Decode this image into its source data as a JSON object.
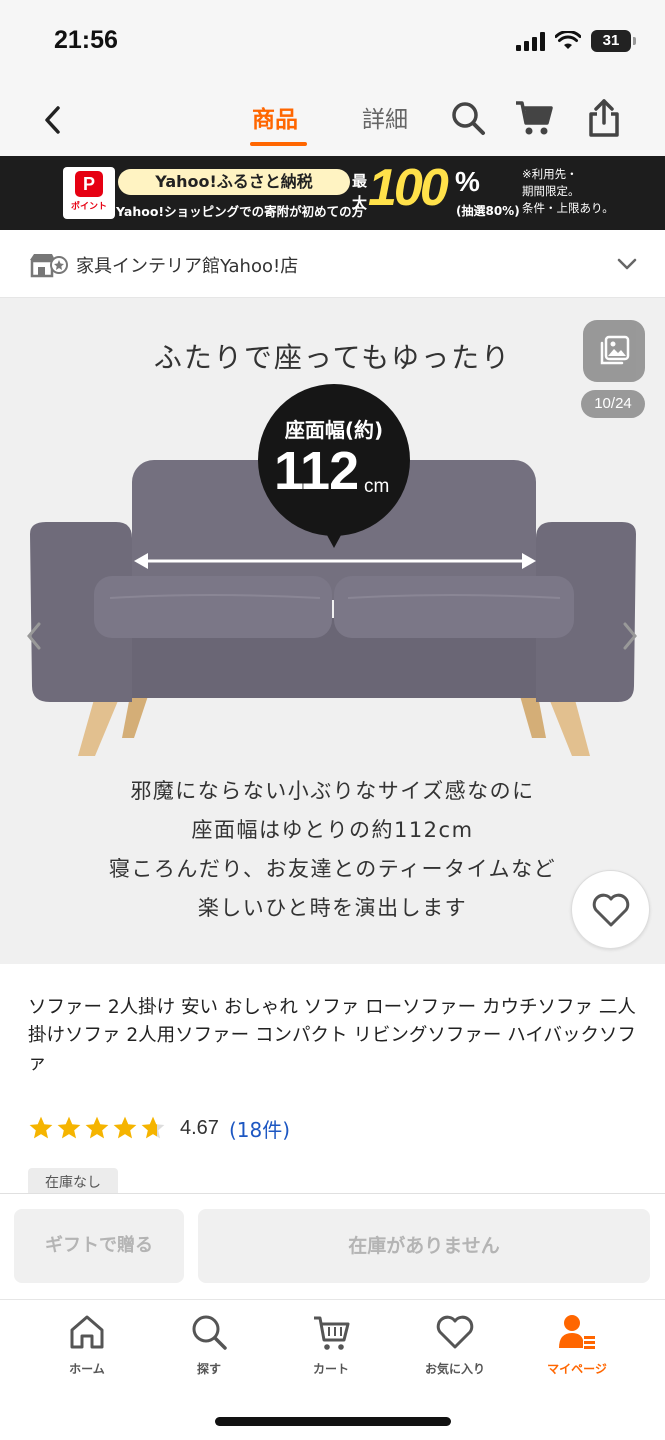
{
  "status_bar": {
    "time": "21:56",
    "battery": "31"
  },
  "header": {
    "tabs": [
      {
        "label": "商品",
        "active": true
      },
      {
        "label": "詳細",
        "active": false
      }
    ],
    "icons": [
      "back-arrow-icon",
      "search-icon",
      "cart-icon",
      "share-icon"
    ]
  },
  "banner": {
    "logo_p": "P",
    "logo_label": "ポイント",
    "headline": "Yahoo!ふるさと納税",
    "sub": "Yahoo!ショッピングでの寄附が初めての方",
    "max_label": "最大",
    "big_number": "100",
    "percent": "%",
    "lottery": "(抽選80%)",
    "note": "※利用先・\n期間限定。\n条件・上限あり。"
  },
  "store": {
    "name": "家具インテリア館Yahoo!店"
  },
  "gallery": {
    "headline": "ふたりで座ってもゆったり",
    "badge_label": "座面幅(約)",
    "badge_number": "112",
    "badge_unit": "cm",
    "caption_lines": [
      "邪魔にならない小ぶりなサイズ感なのに",
      "座面幅はゆとりの約112cm",
      "寝ころんだり、お友達とのティータイムなど",
      "楽しいひと時を演出します"
    ],
    "counter": "10/24"
  },
  "product": {
    "title": "ソファー 2人掛け 安い おしゃれ ソファ ローソファー カウチソファ 二人掛けソファ 2人用ソファー コンパクト リビングソファー ハイバックソファ",
    "rating": 4.67,
    "rating_text": "4.67",
    "review_count": "(18件)",
    "stock_tag": "在庫なし"
  },
  "actions": {
    "gift": "ギフトで贈る",
    "out_of_stock": "在庫がありません"
  },
  "tabbar": {
    "items": [
      {
        "label": "ホーム",
        "icon": "home-icon"
      },
      {
        "label": "探す",
        "icon": "search-icon"
      },
      {
        "label": "カート",
        "icon": "cart-icon"
      },
      {
        "label": "お気に入り",
        "icon": "heart-icon"
      },
      {
        "label": "マイページ",
        "icon": "user-icon",
        "active": true
      }
    ]
  },
  "colors": {
    "accent": "#ff6600",
    "link": "#1d57c2",
    "star": "#f5b400",
    "banner_bg": "#1d1d1d"
  }
}
